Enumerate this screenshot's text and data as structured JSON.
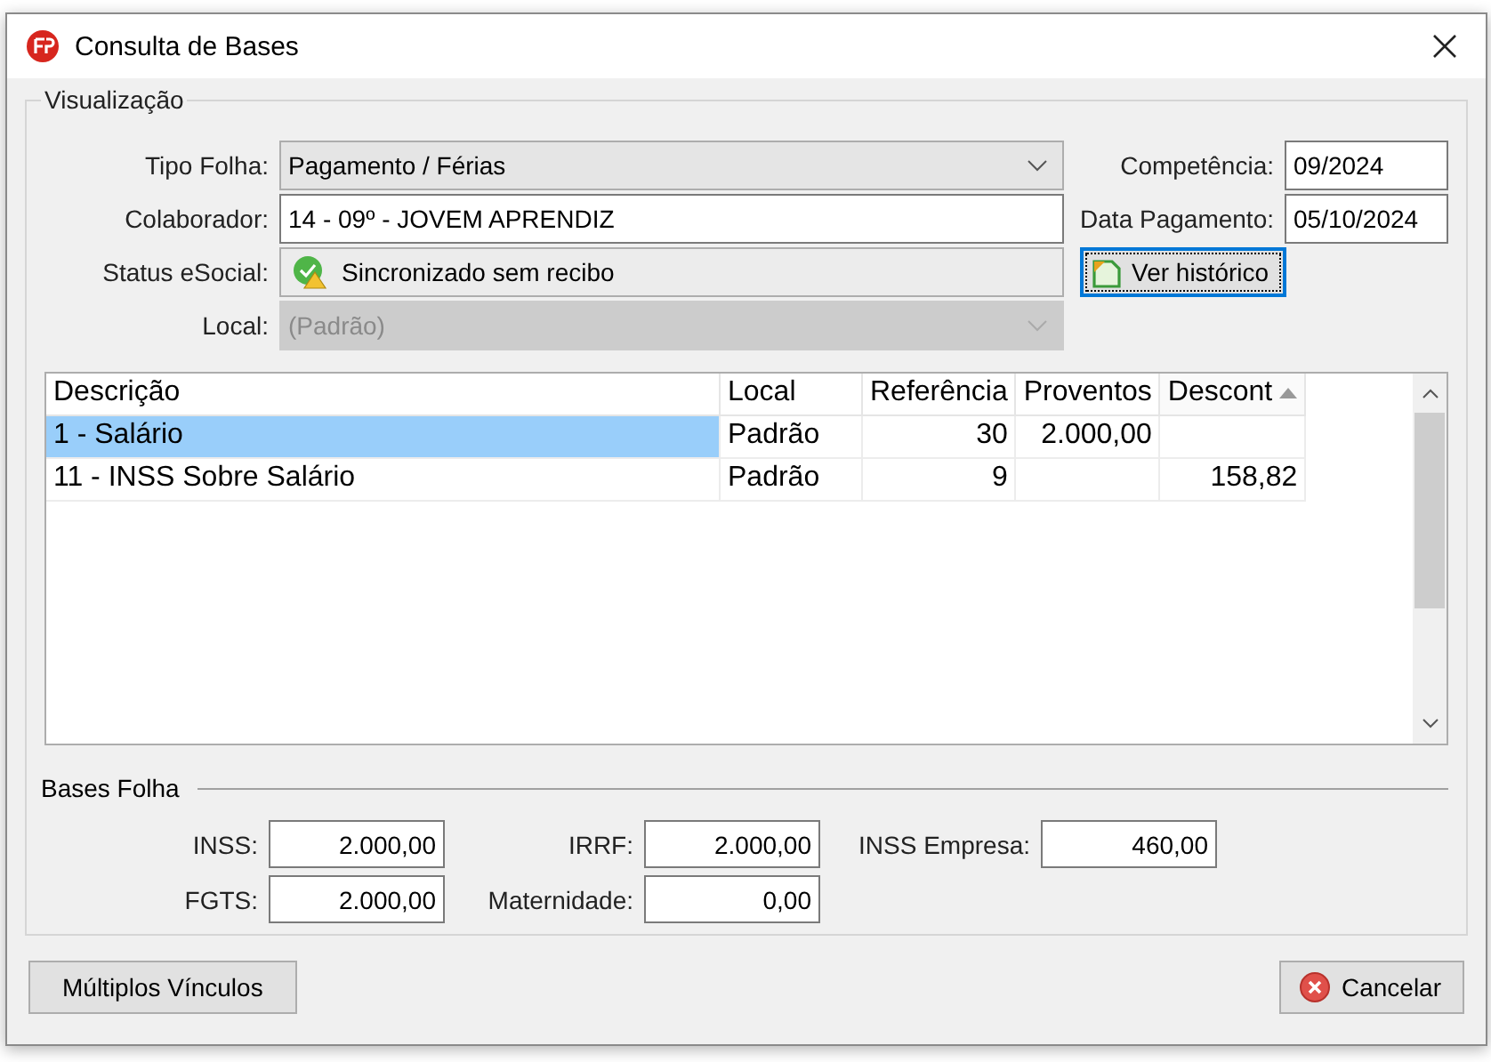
{
  "window": {
    "title": "Consulta de Bases"
  },
  "visualizacao": {
    "title": "Visualização",
    "fields": [
      {
        "kind": "dropdown",
        "label": "Tipo Folha:",
        "value": "Pagamento / Férias",
        "disabled": false
      },
      {
        "kind": "text",
        "label": "Colaborador:",
        "value": "14 - 09º -  JOVEM APRENDIZ",
        "disabled": false
      },
      {
        "kind": "status",
        "label": "Status eSocial:",
        "value": "Sincronizado sem recibo",
        "disabled": false
      },
      {
        "kind": "dropdown",
        "label": "Local:",
        "value": "(Padrão)",
        "disabled": true
      }
    ],
    "side_fields": [
      {
        "label": "Competência:",
        "value": "09/2024"
      },
      {
        "label": "Data Pagamento:",
        "value": "05/10/2024"
      }
    ],
    "history_button": {
      "label": "Ver histórico",
      "focused": true
    }
  },
  "table": {
    "columns": [
      {
        "label": "Descrição",
        "sorted": false
      },
      {
        "label": "Local",
        "sorted": false
      },
      {
        "label": "Referência",
        "sorted": false
      },
      {
        "label": "Proventos",
        "sorted": false
      },
      {
        "label": "Descont",
        "sorted": true
      }
    ],
    "rows": [
      {
        "selected": true,
        "cells": [
          "1 - Salário",
          "Padrão",
          "30",
          "2.000,00",
          ""
        ]
      },
      {
        "selected": false,
        "cells": [
          "11 - INSS Sobre Salário",
          "Padrão",
          "9",
          "",
          "158,82"
        ]
      }
    ]
  },
  "bases_folha": {
    "title": "Bases Folha",
    "fields": [
      {
        "label": "INSS:",
        "value": "2.000,00"
      },
      {
        "label": "IRRF:",
        "value": "2.000,00"
      },
      {
        "label": "INSS Empresa:",
        "value": "460,00"
      },
      {
        "label": "FGTS:",
        "value": "2.000,00"
      },
      {
        "label": "Maternidade:",
        "value": "0,00"
      }
    ]
  },
  "buttons": [
    {
      "kind": "plain",
      "label": "Múltiplos Vínculos"
    },
    {
      "kind": "cancel",
      "label": "Cancelar"
    }
  ]
}
